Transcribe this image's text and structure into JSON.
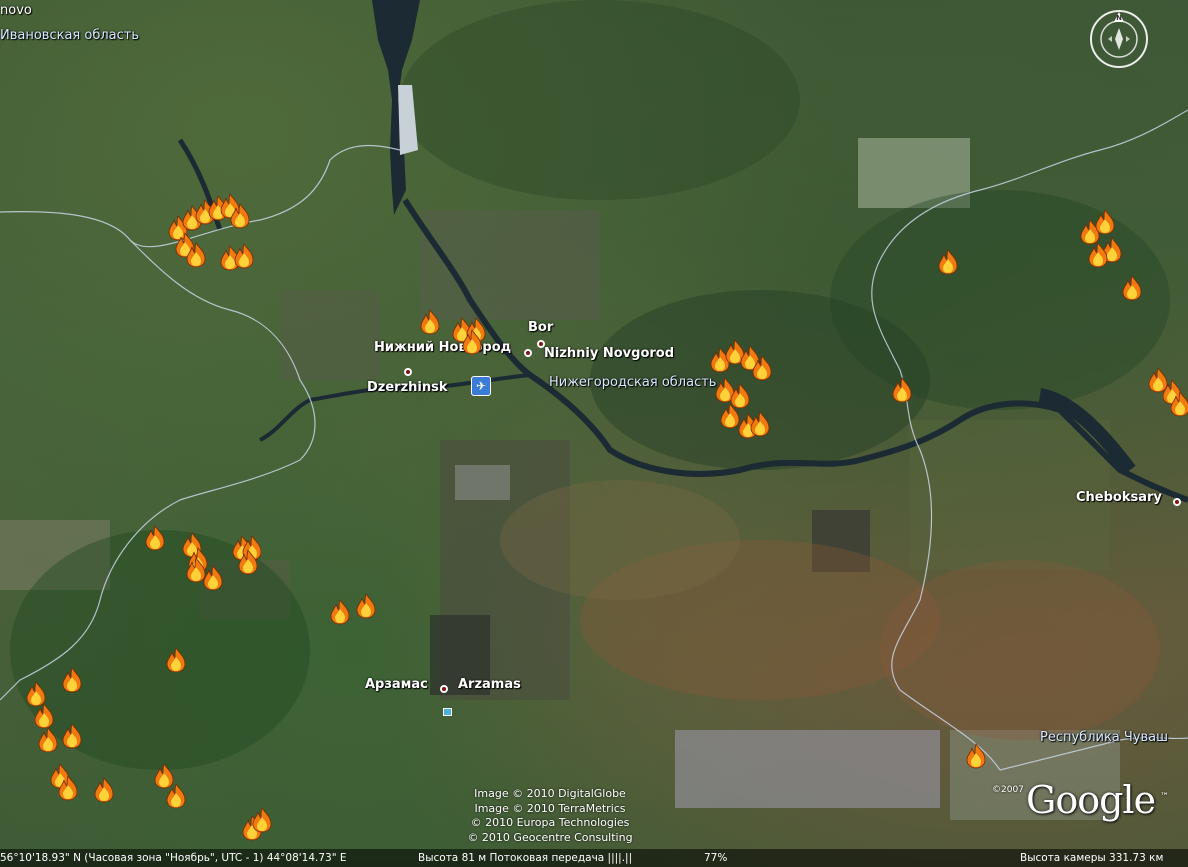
{
  "labels": {
    "top_left_fragment": "novo",
    "ivanovo_region": "Ивановская область",
    "bor": "Bor",
    "nizhny_ru": "Нижний Новгород",
    "nizhny_en": "Nizhniy Novgorod",
    "dzerzhinsk": "Dzerzhinsk",
    "nizhny_region": "Нижегородская область",
    "cheboksary": "Cheboksary",
    "arzamas_ru": "Арзамас",
    "arzamas_en": "Arzamas",
    "chuvash_region": "Республика Чуваш"
  },
  "credits": [
    "Image © 2010 DigitalGlobe",
    "Image © 2010 TerraMetrics",
    "© 2010 Europa Technologies",
    "© 2010 Geocentre Consulting"
  ],
  "logo": {
    "copyright": "©2007",
    "text": "Google",
    "tm": "™"
  },
  "status": {
    "coords": "56°10'18.93\" N (Часовая зона \"Ноябрь\", UTC - 1)  44°08'14.73\" E",
    "altitude": "Высота   81 м Потоковая передача  ||||.||",
    "streaming_percent": "77%",
    "camera": "Высота камеры   331.73 км"
  },
  "icons": {
    "fire": "fire-icon",
    "airport": "airport-icon",
    "compass": "compass-icon"
  },
  "colors": {
    "fire_outer": "#f07a10",
    "fire_inner": "#ffd23a",
    "city_dot": "#8a1010",
    "river": "#1c2a33",
    "border": "#c9d4e4"
  }
}
